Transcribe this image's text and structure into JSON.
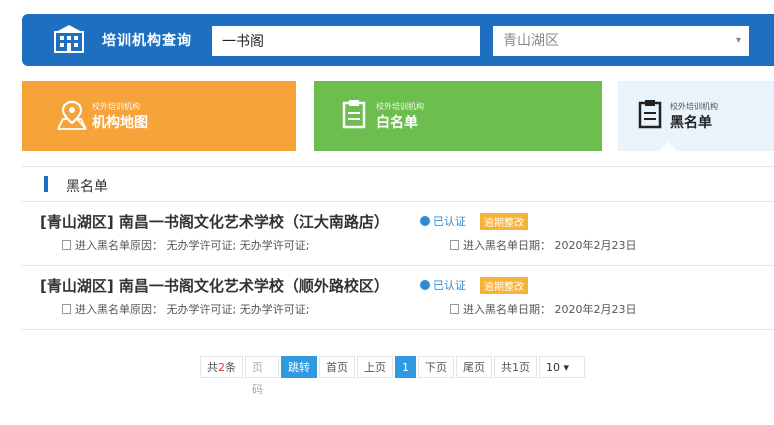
{
  "header": {
    "title": "培训机构查询",
    "search_value": "一书阁",
    "region_value": "青山湖区",
    "select_arrow": "▾"
  },
  "tabs": [
    {
      "small": "校外培训机构",
      "big": "机构地图",
      "icon": "map-pin-icon"
    },
    {
      "small": "校外培训机构",
      "big": "白名单",
      "icon": "clipboard-icon"
    },
    {
      "small": "校外培训机构",
      "big": "黑名单",
      "icon": "clipboard-icon"
    }
  ],
  "section_title": "黑名单",
  "items": [
    {
      "name": "[青山湖区] 南昌一书阁文化艺术学校（江大南路店）",
      "verified": "已认证",
      "expired": "逾期整改",
      "reason": "进入黑名单原因： 无办学许可证; 无办学许可证;",
      "date": "进入黑名单日期： 2020年2月23日"
    },
    {
      "name": "[青山湖区] 南昌一书阁文化艺术学校（顺外路校区）",
      "verified": "已认证",
      "expired": "逾期整改",
      "reason": "进入黑名单原因： 无办学许可证; 无办学许可证;",
      "date": "进入黑名单日期： 2020年2月23日"
    }
  ],
  "pager": {
    "total_prefix": "共",
    "total_count": "2",
    "total_suffix": "条",
    "jump_placeholder": "页码",
    "jump_label": "跳转",
    "first": "首页",
    "prev": "上页",
    "current": "1",
    "next": "下页",
    "last": "尾页",
    "pages": "共1页",
    "page_size": "10 ▾"
  },
  "colors": {
    "header_blue": "#1f6fc0",
    "map_orange": "#f6a33a",
    "white_green": "#6cbf4f",
    "black_tab_bg": "#e8f3fc"
  }
}
